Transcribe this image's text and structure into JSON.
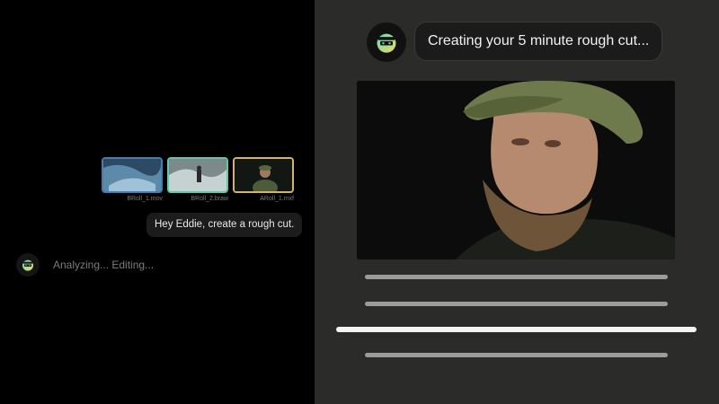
{
  "files": [
    {
      "name": "BRoll_1.mov",
      "color": "#3f7fb8"
    },
    {
      "name": "BRoll_2.braw",
      "color": "#5fc8a9"
    },
    {
      "name": "ARoll_1.mxf",
      "color": "#d6b55b"
    }
  ],
  "user_message": "Hey Eddie, create a rough cut.",
  "status": "Analyzing... Editing...",
  "assistant_message": "Creating your 5 minute rough cut...",
  "icons": {
    "assistant_avatar": "robot-face-icon"
  },
  "colors": {
    "left_background": "#000000",
    "right_background": "#2b2b2a",
    "avatar_gradient_start": "#5fe0c0",
    "avatar_gradient_end": "#f0d860"
  }
}
